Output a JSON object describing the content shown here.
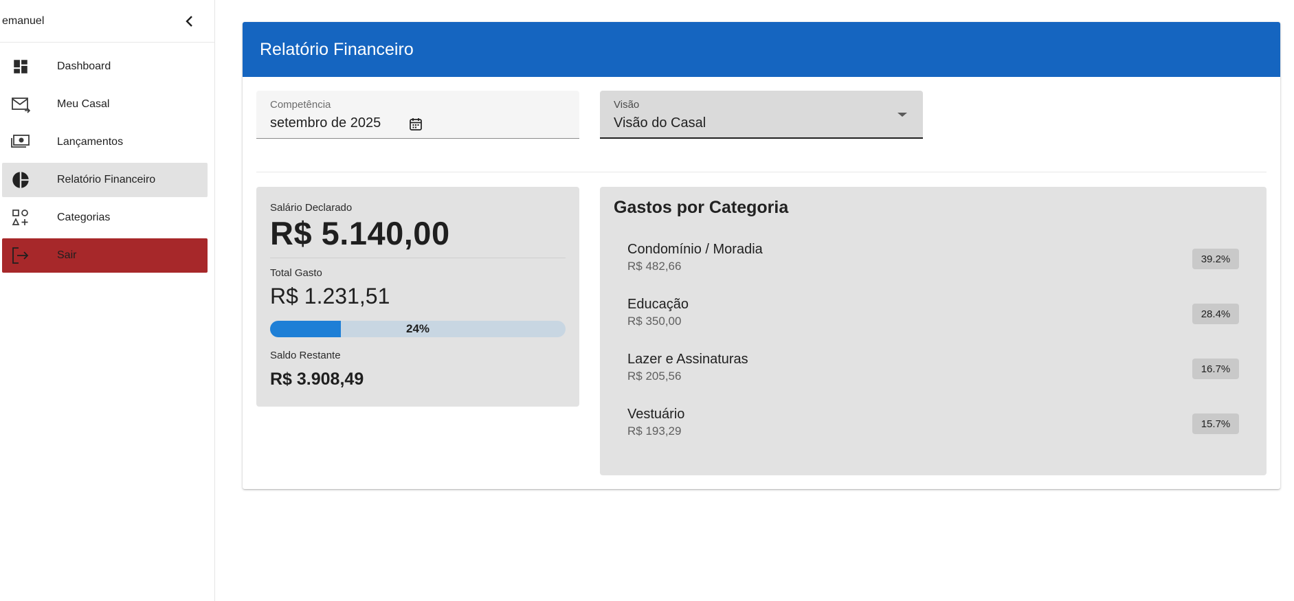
{
  "sidebar": {
    "user_name": "emanuel",
    "items": [
      {
        "label": "Dashboard",
        "icon": "dashboard-icon",
        "state": "active"
      },
      {
        "label": "Meu Casal",
        "icon": "mail-icon",
        "state": "normal"
      },
      {
        "label": "Lançamentos",
        "icon": "money-icon",
        "state": "normal"
      },
      {
        "label": "Relatório Financeiro",
        "icon": "pie-chart-icon",
        "state": "active"
      },
      {
        "label": "Categorias",
        "icon": "category-icon",
        "state": "normal"
      },
      {
        "label": "Sair",
        "icon": "logout-icon",
        "state": "danger"
      }
    ]
  },
  "report": {
    "title": "Relatório Financeiro",
    "competencia": {
      "label": "Competência",
      "value": "setembro de 2025"
    },
    "visao": {
      "label": "Visão",
      "value": "Visão do Casal"
    }
  },
  "summary": {
    "salario_label": "Salário Declarado",
    "salario_value": "R$ 5.140,00",
    "gasto_label": "Total Gasto",
    "gasto_value": "R$ 1.231,51",
    "progress_text": "24%",
    "progress_fraction": 0.24,
    "saldo_label": "Saldo Restante",
    "saldo_value": "R$ 3.908,49"
  },
  "categories": {
    "title": "Gastos por Categoria",
    "items": [
      {
        "name": "Condomínio / Moradia",
        "value": "R$ 482,66",
        "percent": "39.2%"
      },
      {
        "name": "Educação",
        "value": "R$ 350,00",
        "percent": "28.4%"
      },
      {
        "name": "Lazer e Assinaturas",
        "value": "R$ 205,56",
        "percent": "16.7%"
      },
      {
        "name": "Vestuário",
        "value": "R$ 193,29",
        "percent": "15.7%"
      }
    ]
  },
  "colors": {
    "header": "#1565c0",
    "progress_fill": "#1e7fd6",
    "progress_track": "#c8d6e2",
    "logout_bg": "#a7282a",
    "active_bg": "#e2e2e2"
  }
}
